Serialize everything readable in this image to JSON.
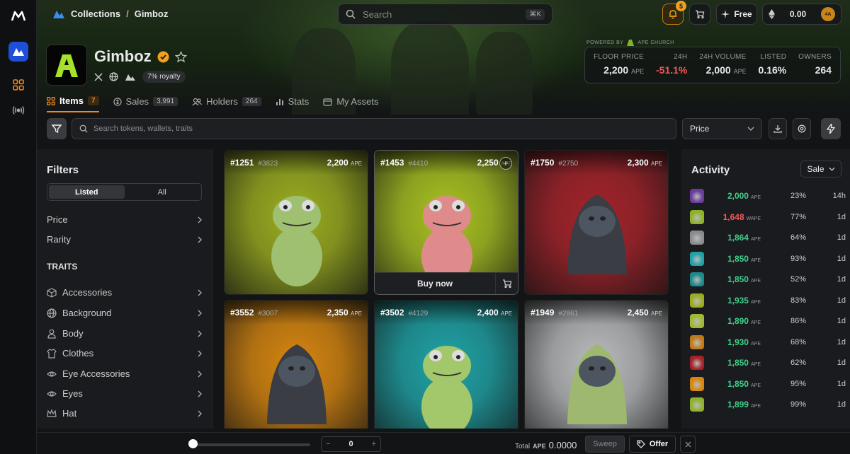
{
  "breadcrumb": {
    "collections": "Collections",
    "separator": "/",
    "current": "Gimboz"
  },
  "search": {
    "placeholder": "Search",
    "shortcut": "⌘K"
  },
  "topbar": {
    "notifications_count": "5",
    "free_label": "Free",
    "balance": "0.00",
    "avatar_initials": "4A"
  },
  "collection": {
    "name": "Gimboz",
    "royalty": "7% royalty"
  },
  "powered_by": {
    "label": "POWERED BY",
    "partner": "APE CHURCH"
  },
  "stats": [
    {
      "label": "FLOOR PRICE",
      "value": "2,200",
      "unit": "APE"
    },
    {
      "label": "24H",
      "value": "-51.1%",
      "unit": ""
    },
    {
      "label": "24H VOLUME",
      "value": "2,000",
      "unit": "APE"
    },
    {
      "label": "LISTED",
      "value": "0.16%",
      "unit": ""
    },
    {
      "label": "OWNERS",
      "value": "264",
      "unit": ""
    }
  ],
  "tabs": [
    {
      "label": "Items",
      "count": "7"
    },
    {
      "label": "Sales",
      "count": "3,991"
    },
    {
      "label": "Holders",
      "count": "264"
    },
    {
      "label": "Stats",
      "count": ""
    },
    {
      "label": "My Assets",
      "count": ""
    }
  ],
  "filter_bar": {
    "search_placeholder": "Search tokens, wallets, traits",
    "sort_value": "Price"
  },
  "filters": {
    "title": "Filters",
    "segment": [
      "Listed",
      "All"
    ],
    "general": [
      "Price",
      "Rarity"
    ],
    "traits_title": "TRAITS",
    "traits": [
      "Accessories",
      "Background",
      "Body",
      "Clothes",
      "Eye Accessories",
      "Eyes",
      "Hat"
    ]
  },
  "items": [
    {
      "id": "#1251",
      "rank": "#3823",
      "price": "2,200",
      "unit": "APE",
      "bg": "#9bad1f",
      "skin": "#9fc070",
      "hood": false
    },
    {
      "id": "#1453",
      "rank": "#4410",
      "price": "2,250",
      "unit": "APE",
      "bg": "#a9c221",
      "skin": "#e08b8b",
      "hood": false
    },
    {
      "id": "#1750",
      "rank": "#2750",
      "price": "2,300",
      "unit": "APE",
      "bg": "#a4232a",
      "skin": "#3a3d44",
      "hood": true
    },
    {
      "id": "#3552",
      "rank": "#3007",
      "price": "2,350",
      "unit": "APE",
      "bg": "#d6860f",
      "skin": "#3a3d44",
      "hood": true
    },
    {
      "id": "#3502",
      "rank": "#4129",
      "price": "2,400",
      "unit": "APE",
      "bg": "#1fa3a6",
      "skin": "#a3c86c",
      "hood": false
    },
    {
      "id": "#1949",
      "rank": "#2861",
      "price": "2,450",
      "unit": "APE",
      "bg": "#b9bbbd",
      "skin": "#9fb870",
      "hood": true
    }
  ],
  "buy_now_label": "Buy now",
  "activity": {
    "title": "Activity",
    "filter": "Sale",
    "rows": [
      {
        "price": "2,000",
        "unit": "APE",
        "pct": "23%",
        "time": "14h",
        "color": "#3fd08a",
        "thumb": "#6a3c9a"
      },
      {
        "price": "1,648",
        "unit": "WAPE",
        "pct": "77%",
        "time": "1d",
        "color": "#f05a5a",
        "thumb": "#8fb22a"
      },
      {
        "price": "1,864",
        "unit": "APE",
        "pct": "64%",
        "time": "1d",
        "color": "#3fd08a",
        "thumb": "#8a8c8e"
      },
      {
        "price": "1,850",
        "unit": "APE",
        "pct": "93%",
        "time": "1d",
        "color": "#3fd08a",
        "thumb": "#1fa3a6"
      },
      {
        "price": "1,850",
        "unit": "APE",
        "pct": "52%",
        "time": "1d",
        "color": "#3fd08a",
        "thumb": "#1c8a8a"
      },
      {
        "price": "1,935",
        "unit": "APE",
        "pct": "83%",
        "time": "1d",
        "color": "#3fd08a",
        "thumb": "#9bad1f"
      },
      {
        "price": "1,890",
        "unit": "APE",
        "pct": "86%",
        "time": "1d",
        "color": "#3fd08a",
        "thumb": "#a0b832"
      },
      {
        "price": "1,930",
        "unit": "APE",
        "pct": "68%",
        "time": "1d",
        "color": "#3fd08a",
        "thumb": "#c07a1a"
      },
      {
        "price": "1,850",
        "unit": "APE",
        "pct": "62%",
        "time": "1d",
        "color": "#3fd08a",
        "thumb": "#a4232a"
      },
      {
        "price": "1,850",
        "unit": "APE",
        "pct": "95%",
        "time": "1d",
        "color": "#3fd08a",
        "thumb": "#d6860f"
      },
      {
        "price": "1,899",
        "unit": "APE",
        "pct": "99%",
        "time": "1d",
        "color": "#3fd08a",
        "thumb": "#8fb22a"
      }
    ]
  },
  "bottom": {
    "quantity": "0",
    "total_label": "Total",
    "total_unit": "APE",
    "total_value": "0.0000",
    "sweep_label": "Sweep",
    "offer_label": "Offer",
    "minus": "−",
    "plus": "+"
  },
  "colors": {
    "accent": "#f08a1c",
    "positive": "#3fd08a",
    "negative": "#f05a5a",
    "brand_logo": "#a7e22a",
    "link": "#3a8ef0"
  }
}
